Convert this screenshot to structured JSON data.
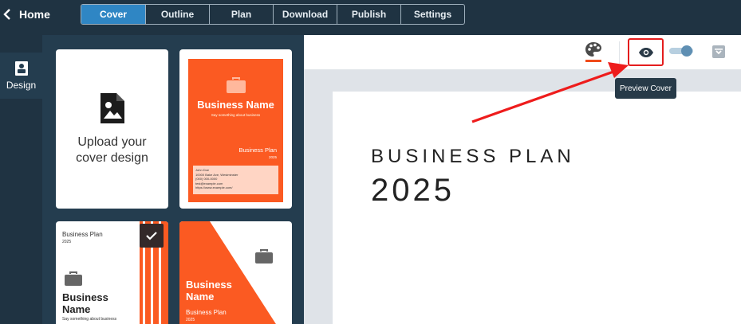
{
  "header": {
    "home_label": "Home",
    "tabs": [
      "Cover",
      "Outline",
      "Plan",
      "Download",
      "Publish",
      "Settings"
    ],
    "active_tab": "Cover"
  },
  "rail": {
    "design_label": "Design"
  },
  "templates": {
    "upload_label": "Upload your cover design",
    "t1": {
      "name": "Business Name",
      "tagline": "Say something about business",
      "plan": "Business Plan",
      "year": "2025",
      "contact": [
        "John Doe",
        "10000 Bake Ave, Westminster",
        "(000) 000-0000",
        "test@example.com",
        "https://www.example.com/"
      ]
    },
    "t2": {
      "plan": "Business Plan",
      "year": "2025",
      "name_line1": "Business",
      "name_line2": "Name",
      "tagline": "Say something about business"
    },
    "t3": {
      "name_line1": "Business",
      "name_line2": "Name",
      "plan": "Business Plan",
      "year": "2025"
    }
  },
  "preview": {
    "title": "BUSINESS PLAN",
    "year": "2025",
    "tooltip": "Preview Cover"
  },
  "colors": {
    "accent": "#fb5a22",
    "tab_active": "#2f86c4",
    "highlight": "#e41d1d"
  },
  "icons": [
    "chevron-left-icon",
    "portrait-icon",
    "image-upload-icon",
    "briefcase-icon",
    "checkmark-icon",
    "palette-icon",
    "eye-icon",
    "toggle-switch",
    "archive-icon"
  ]
}
